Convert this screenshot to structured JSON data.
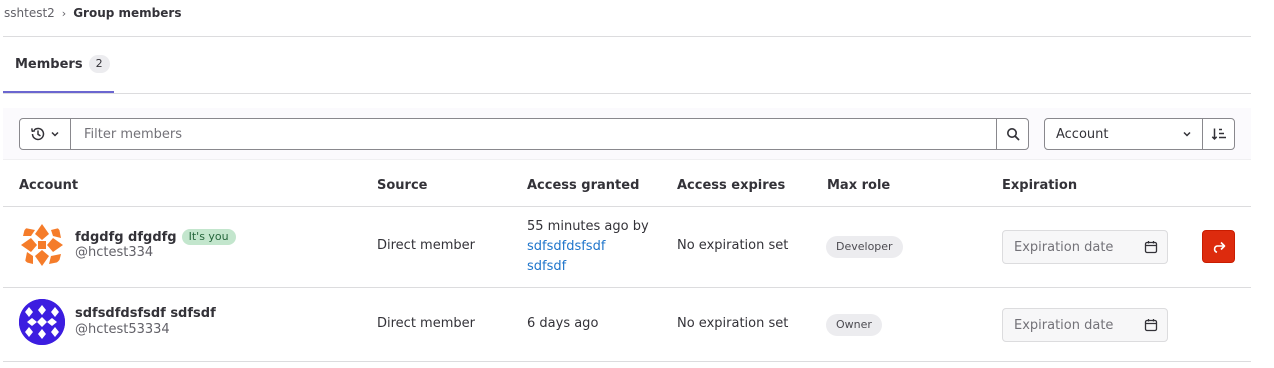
{
  "breadcrumb": {
    "parent": "sshtest2",
    "separator": "›",
    "current": "Group members"
  },
  "tabs": [
    {
      "label": "Members",
      "count": "2"
    }
  ],
  "filter": {
    "placeholder": "Filter members",
    "sort_label": "Account",
    "icons": {
      "history": "history-icon",
      "chevron": "chevron-down-icon",
      "search": "search-icon",
      "sort_direction": "sort-lowest-icon"
    }
  },
  "table": {
    "headers": [
      "Account",
      "Source",
      "Access granted",
      "Access expires",
      "Max role",
      "Expiration"
    ],
    "rows": [
      {
        "name": "fdgdfg dfgdfg",
        "badge": "It's you",
        "username": "@hctest334",
        "source": "Direct member",
        "access_granted_text": "55 minutes ago by",
        "access_granted_by": "sdfsdfdsfsdf sdfsdf",
        "access_granted_by_line1": "sdfsdfdsfsdf",
        "access_granted_by_line2": "sdfsdf",
        "access_expires": "No expiration set",
        "max_role": "Developer",
        "expiration_placeholder": "Expiration date",
        "action_icon": "leave-icon",
        "avatar_color": "#f57c2a"
      },
      {
        "name": "sdfsdfdsfsdf sdfsdf",
        "username": "@hctest53334",
        "source": "Direct member",
        "access_granted_text": "6 days ago",
        "access_expires": "No expiration set",
        "max_role": "Owner",
        "expiration_placeholder": "Expiration date",
        "avatar_color": "#3c1de0"
      }
    ]
  },
  "colors": {
    "accent": "#6b66d0",
    "danger": "#dd2b0e",
    "link": "#1f75cb",
    "you_badge_bg": "#c3e6cd"
  }
}
